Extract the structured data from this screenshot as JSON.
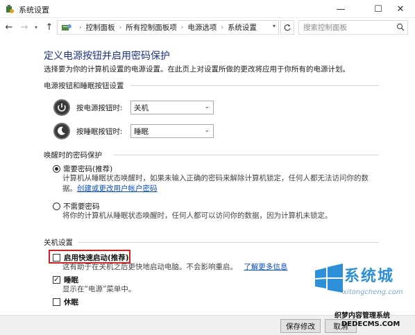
{
  "window": {
    "title": "系统设置",
    "minimize_glyph": "—",
    "maximize_glyph": "☐",
    "close_glyph": "✕"
  },
  "nav": {
    "back_glyph": "←",
    "forward_glyph": "→",
    "up_glyph": "↑",
    "breadcrumbs": [
      "控制面板",
      "所有控制面板项",
      "电源选项",
      "系统设置"
    ],
    "search_placeholder": "搜索控制面板"
  },
  "page": {
    "title": "定义电源按钮并启用密码保护",
    "description": "选择要为你的计算机设置的电源设置。在此页上对设置所做的更改将应用于你所有的电源计划。"
  },
  "power_section": {
    "heading": "电源按钮和睡眠按钮设置",
    "power_button_label": "按电源按钮时:",
    "power_button_value": "关机",
    "sleep_button_label": "按睡眠按钮时:",
    "sleep_button_value": "睡眠"
  },
  "password_section": {
    "heading": "唤醒时的密码保护",
    "require_label": "需要密码(推荐)",
    "require_desc": "计算机从睡眠状态唤醒时，如果未输入正确的密码来解除计算机锁定，任何人都无法访问你的数",
    "require_desc2": "据。",
    "create_link": "创建或更改用户帐户密码",
    "no_require_label": "不需要密码",
    "no_require_desc": "将你的计算机从睡眠状态唤醒时，任何人都可以访问你的数据，因为计算机未锁定。"
  },
  "shutdown_section": {
    "heading": "关机设置",
    "fast_startup_label": "启用快速启动(推荐)",
    "fast_startup_desc": "这有助于在关机之后更快地启动电脑。不会影响重启。",
    "learn_more_link": "了解更多信息",
    "sleep_label": "睡眠",
    "sleep_desc": "显示在“电源”菜单中。",
    "hibernate_label": "休眠"
  },
  "footer": {
    "save_label": "保存修改",
    "cancel_label": "取消"
  },
  "watermark": {
    "main": "系统城",
    "site": "xitongcheng.com",
    "sub": "织梦内容管理系统",
    "sub2": "DEDECMS.COM"
  },
  "colors": {
    "title_blue": "#1e3287",
    "link_blue": "#0b4fc4",
    "highlight_red": "#d21f1f"
  }
}
